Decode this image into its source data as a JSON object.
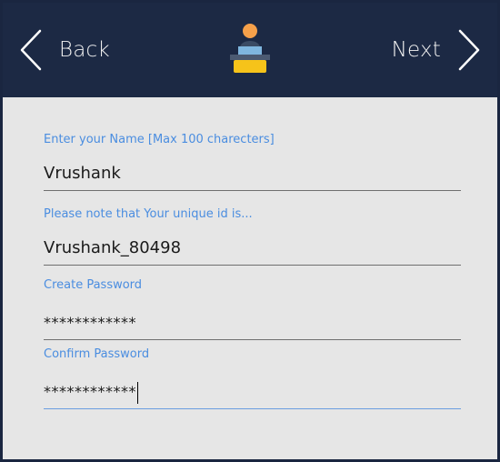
{
  "header": {
    "back_label": "Back",
    "next_label": "Next"
  },
  "form": {
    "name": {
      "label": "Enter your Name [Max 100 charecters]",
      "value": "Vrushank"
    },
    "unique_id": {
      "label": "Please note that Your unique id is...",
      "value": "Vrushank_80498"
    },
    "create_password": {
      "label": "Create Password",
      "value": "************"
    },
    "confirm_password": {
      "label": "Confirm Password",
      "value": "************"
    }
  },
  "colors": {
    "header_bg": "#1c2944",
    "panel_bg": "#e6e6e6",
    "label_blue": "#4a8de0",
    "logo_yellow": "#f6c31a",
    "logo_orange": "#f5a04a",
    "logo_blue": "#7fb6df"
  }
}
